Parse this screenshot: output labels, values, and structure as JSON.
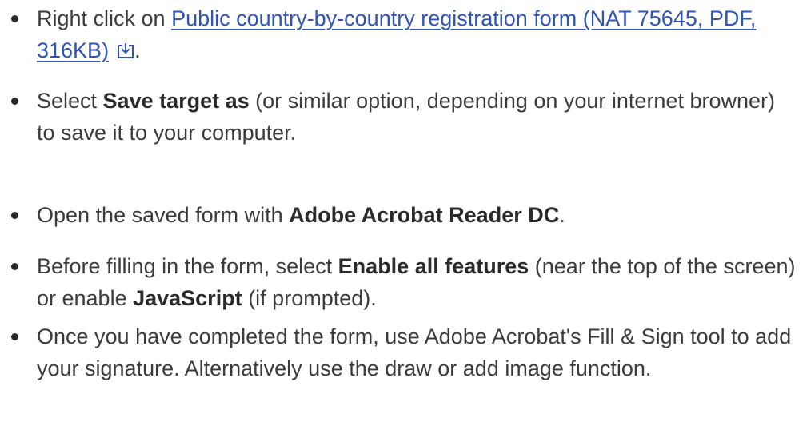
{
  "items": [
    {
      "prefix": "Right click on ",
      "link_text": "Public country-by-country registration form (NAT 75645, PDF, 316KB)",
      "icon": "download-icon",
      "suffix": "."
    },
    {
      "prefix": "Select ",
      "bold": "Save target as",
      "suffix": " (or similar option, depending on your internet browner) to save it to your computer."
    },
    {
      "prefix": "Open the saved form with ",
      "bold": "Adobe Acrobat Reader DC",
      "suffix": "."
    },
    {
      "prefix": "Before filling in the form, select ",
      "bold": "Enable all features",
      "middle": " (near the top of the screen) or enable ",
      "bold2": "JavaScript",
      "suffix": " (if prompted)."
    },
    {
      "text": "Once you have completed the form, use Adobe Acrobat's Fill & Sign tool to add your signature. Alternatively use the draw or add image function."
    }
  ],
  "colors": {
    "link": "#2f54b4",
    "text": "#3b3b3b"
  }
}
